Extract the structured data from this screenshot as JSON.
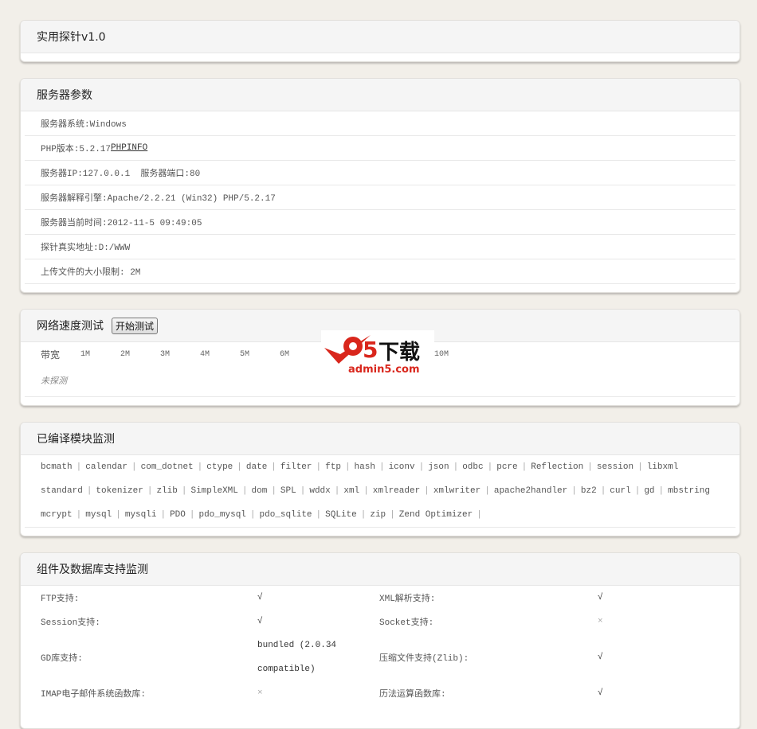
{
  "title": "实用探针v1.0",
  "server": {
    "title": "服务器参数",
    "rows": [
      "服务器系统:Windows",
      "PHP版本:5.2.17",
      "服务器IP:127.0.0.1  服务器端口:80",
      "服务器解释引擎:Apache/2.2.21 (Win32) PHP/5.2.17",
      "服务器当前时间:2012-11-5 09:49:05",
      "探针真实地址:D:/WWW",
      "上传文件的大小限制: 2M"
    ],
    "phpinfo_link": "PHPINFO"
  },
  "network": {
    "title": "网络速度测试",
    "start_button": "开始测试",
    "bandwidth_label": "带宽",
    "ticks": [
      "1M",
      "2M",
      "3M",
      "4M",
      "5M",
      "6M",
      "10M"
    ],
    "status": "未探测"
  },
  "watermark": {
    "text": "a5下载",
    "url_text": "admin5.com"
  },
  "modules": {
    "title": "已编译模块监测",
    "lines": [
      [
        "bcmath",
        "calendar",
        "com_dotnet",
        "ctype",
        "date",
        "filter",
        "ftp",
        "hash",
        "iconv",
        "json",
        "odbc",
        "pcre",
        "Reflection",
        "session",
        "libxml"
      ],
      [
        "standard",
        "tokenizer",
        "zlib",
        "SimpleXML",
        "dom",
        "SPL",
        "wddx",
        "xml",
        "xmlreader",
        "xmlwriter",
        "apache2handler",
        "bz2",
        "curl",
        "gd",
        "mbstring"
      ],
      [
        "mcrypt",
        "mysql",
        "mysqli",
        "PDO",
        "pdo_mysql",
        "pdo_sqlite",
        "SQLite",
        "zip",
        "Zend Optimizer"
      ]
    ]
  },
  "components": {
    "title": "组件及数据库支持监测",
    "rows": [
      [
        "FTP支持:",
        "√",
        "XML解析支持:",
        "√"
      ],
      [
        "Session支持:",
        "√",
        "Socket支持:",
        "×"
      ],
      [
        "GD库支持:",
        "bundled (2.0.34 compatible)",
        "压缩文件支持(Zlib):",
        "√"
      ],
      [
        "IMAP电子邮件系统函数库:",
        "×",
        "历法运算函数库:",
        "√"
      ]
    ]
  }
}
